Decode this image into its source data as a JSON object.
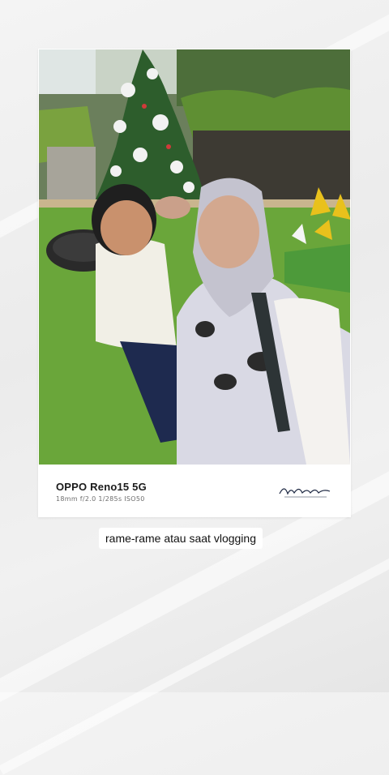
{
  "photo_card": {
    "device_name": "OPPO Reno15 5G",
    "shot_specs": "18mm  f/2.0  1/285s  ISO50",
    "signature_text": "Khaynah coping"
  },
  "caption": {
    "text": "rame-rame atau saat vlogging"
  },
  "colors": {
    "background": "#eeeeee",
    "card": "#ffffff",
    "caption_bg": "#ffffff",
    "caption_text": "#111111"
  }
}
